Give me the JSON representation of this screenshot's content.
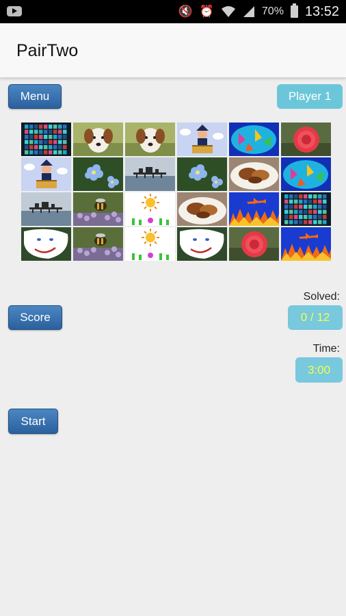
{
  "status_bar": {
    "battery_percent": "70%",
    "time": "13:52",
    "icons": [
      "youtube-icon",
      "mute-icon",
      "alarm-icon",
      "wifi-icon",
      "signal-icon",
      "battery-icon"
    ]
  },
  "app": {
    "title": "PairTwo"
  },
  "toolbar": {
    "menu_label": "Menu",
    "player_label": "Player 1"
  },
  "board": {
    "rows": [
      [
        "disco-ball",
        "dog",
        "dog",
        "cartoon-boy",
        "balloons-art",
        "red-flower"
      ],
      [
        "cartoon-boy",
        "blue-flowers",
        "pier",
        "blue-flowers",
        "food-plate",
        "balloons-art"
      ],
      [
        "pier",
        "bee-lavender",
        "sun-drawing",
        "food-plate",
        "plane-fire",
        "disco-ball"
      ],
      [
        "face-drawing",
        "bee-lavender",
        "sun-drawing",
        "face-drawing",
        "red-flower",
        "plane-fire"
      ]
    ]
  },
  "score": {
    "button_label": "Score",
    "solved_label": "Solved:",
    "solved_value": "0 / 12"
  },
  "timer": {
    "label": "Time:",
    "value": "3:00"
  },
  "start": {
    "button_label": "Start"
  },
  "colors": {
    "dark_button": "#2f67a6",
    "light_button": "#6cc6da",
    "value_text": "#f4ff4a"
  }
}
